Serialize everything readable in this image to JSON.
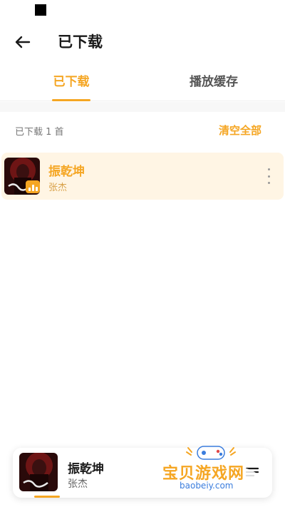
{
  "app_bar": {
    "title": "已下载",
    "back_icon": "arrow-left-icon"
  },
  "tabs": [
    {
      "label": "已下载",
      "active": true
    },
    {
      "label": "播放缓存",
      "active": false
    }
  ],
  "list": {
    "count_text": "已下载 1 首",
    "clear_all_label": "清空全部",
    "items": [
      {
        "title": "振乾坤",
        "artist": "张杰",
        "playing": true
      }
    ]
  },
  "mini_player": {
    "title": "振乾坤",
    "artist": "张杰",
    "progress": 0.1
  },
  "watermark": {
    "title": "宝贝游戏网",
    "url": "baobeiy.com"
  },
  "colors": {
    "accent": "#f5a623",
    "row_highlight": "#fff5e4"
  }
}
